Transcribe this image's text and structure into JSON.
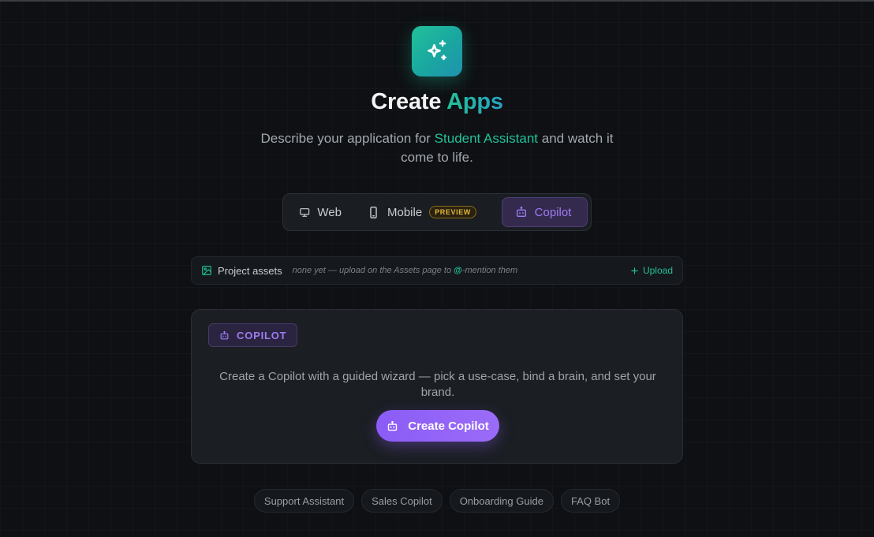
{
  "header": {
    "title_part1": "Create",
    "title_part2": "Apps",
    "subtitle_before": "Describe your application for ",
    "subtitle_highlight": "Student Assistant",
    "subtitle_after": " and watch it come to life."
  },
  "mode_switch": {
    "tabs": [
      {
        "label": "Web",
        "icon": "monitor-icon",
        "active": false
      },
      {
        "label": "Mobile",
        "icon": "phone-icon",
        "badge": "PREVIEW",
        "active": false
      },
      {
        "label": "Copilot",
        "icon": "robot-icon",
        "active": true
      }
    ]
  },
  "assets": {
    "label": "Project assets",
    "hint_before": "none yet — upload on the Assets page to ",
    "hint_at": "@",
    "hint_after": "-mention them",
    "upload_label": "Upload"
  },
  "card": {
    "tag": "COPILOT",
    "description": "Create a Copilot with a guided wizard — pick a use-case, bind a brain, and set your brand.",
    "button_label": "Create Copilot"
  },
  "suggestions": [
    "Support Assistant",
    "Sales Copilot",
    "Onboarding Guide",
    "FAQ Bot"
  ],
  "colors": {
    "accent_green": "#22c19a",
    "accent_purple": "#8b5cf6",
    "background": "#0e1013"
  }
}
